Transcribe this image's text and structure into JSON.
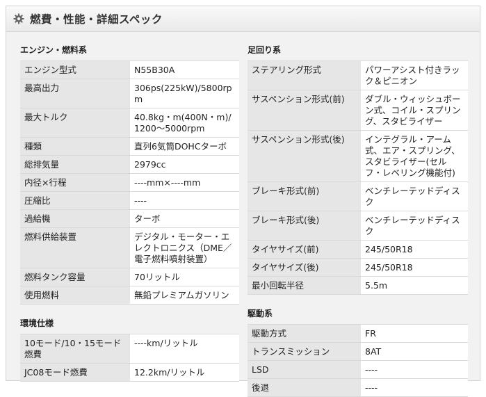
{
  "header": {
    "title": "燃費・性能・詳細スペック",
    "icon": "gear-icon"
  },
  "left": {
    "sections": [
      {
        "title": "エンジン・燃料系",
        "rows": [
          {
            "label": "エンジン型式",
            "value": "N55B30A"
          },
          {
            "label": "最高出力",
            "value": "306ps(225kW)/5800rpm"
          },
          {
            "label": "最大トルク",
            "value": "40.8kg・m(400N・m)/1200～5000rpm"
          },
          {
            "label": "種類",
            "value": "直列6気筒DOHCターボ"
          },
          {
            "label": "総排気量",
            "value": "2979cc"
          },
          {
            "label": "内径×行程",
            "value": "----mm×----mm"
          },
          {
            "label": "圧縮比",
            "value": "----"
          },
          {
            "label": "過給機",
            "value": "ターボ"
          },
          {
            "label": "燃料供給装置",
            "value": "デジタル・モーター・エレクトロニクス（DME／電子燃料噴射装置）"
          },
          {
            "label": "燃料タンク容量",
            "value": "70リットル"
          },
          {
            "label": "使用燃料",
            "value": "無鉛プレミアムガソリン"
          }
        ]
      },
      {
        "title": "環境仕様",
        "rows": [
          {
            "label": "10モード/10・15モード燃費",
            "value": "----km/リットル"
          },
          {
            "label": "JC08モード燃費",
            "value": "12.2km/リットル"
          }
        ]
      }
    ]
  },
  "right": {
    "sections": [
      {
        "title": "足回り系",
        "rows": [
          {
            "label": "ステアリング形式",
            "value": "パワーアシスト付きラック＆ピニオン"
          },
          {
            "label": "サスペンション形式(前)",
            "value": "ダブル・ウィッシュボーン式、コイル・スプリング、スタビライザー"
          },
          {
            "label": "サスペンション形式(後)",
            "value": "インテグラル・アーム式、エア・スプリング、スタビライザー(セルフ・レベリング機能付)"
          },
          {
            "label": "ブレーキ形式(前)",
            "value": "ベンチレーテッドディスク"
          },
          {
            "label": "ブレーキ形式(後)",
            "value": "ベンチレーテッドディスク"
          },
          {
            "label": "タイヤサイズ(前)",
            "value": "245/50R18"
          },
          {
            "label": "タイヤサイズ(後)",
            "value": "245/50R18"
          },
          {
            "label": "最小回転半径",
            "value": "5.5m"
          }
        ]
      },
      {
        "title": "駆動系",
        "rows": [
          {
            "label": "駆動方式",
            "value": "FR"
          },
          {
            "label": "トランスミッション",
            "value": "8AT"
          },
          {
            "label": "LSD",
            "value": "----"
          },
          {
            "label": "後退",
            "value": "----"
          }
        ]
      }
    ]
  }
}
